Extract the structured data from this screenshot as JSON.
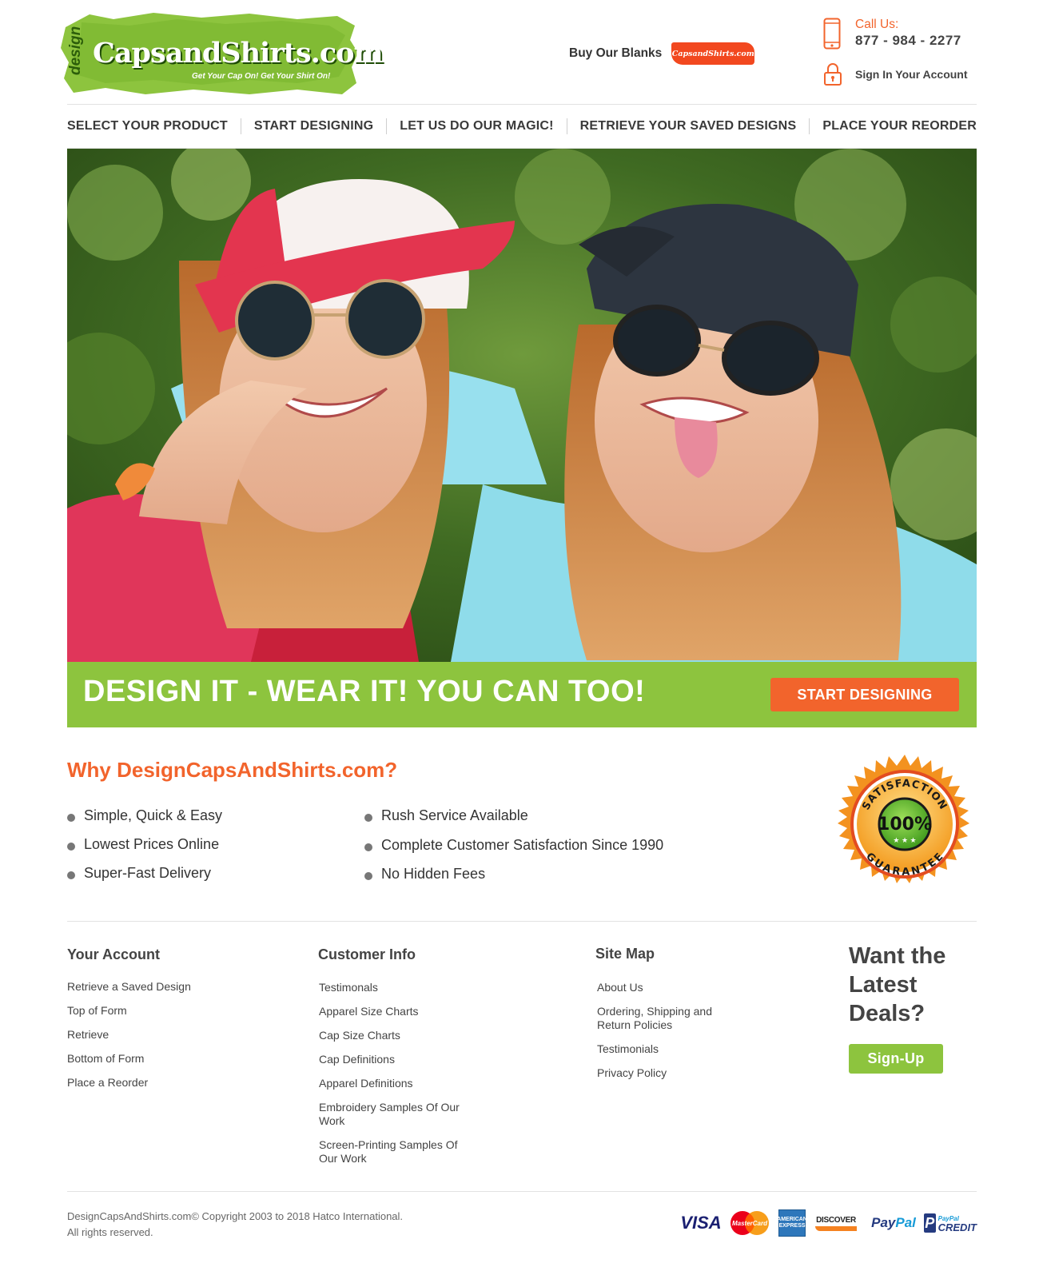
{
  "header": {
    "logo": {
      "prefix": "design",
      "name": "CapsandShirts.com",
      "tagline": "Get Your Cap On! Get Your Shirt On!"
    },
    "blanks_label": "Buy Our Blanks",
    "blanks_badge": "CapsandShirts.com",
    "call_label": "Call Us:",
    "phone": "877 - 984 - 2277",
    "signin_label": "Sign In Your Account"
  },
  "nav": [
    "SELECT YOUR PRODUCT",
    "START DESIGNING",
    "LET US DO OUR MAGIC!",
    "RETRIEVE YOUR SAVED DESIGNS",
    "PLACE YOUR REORDER"
  ],
  "hero": {
    "headline": "DESIGN IT - WEAR IT!  YOU CAN TOO!",
    "cta": "START DESIGNING"
  },
  "why": {
    "title": "Why DesignCapsAndShirts.com?",
    "features_left": [
      "Simple, Quick & Easy",
      "Lowest Prices Online",
      "Super-Fast Delivery"
    ],
    "features_right": [
      "Rush Service Available",
      "Complete Customer Satisfaction Since 1990",
      "No Hidden Fees"
    ],
    "seal": {
      "top": "SATISFACTION",
      "center": "100%",
      "bottom": "GUARANTEE"
    }
  },
  "footer": {
    "account": {
      "heading": "Your Account",
      "links": [
        "Retrieve a Saved Design",
        "Top of Form",
        "Retrieve",
        "Bottom of Form",
        "Place a Reorder"
      ]
    },
    "customer": {
      "heading": "Customer Info",
      "links": [
        "Testimonals",
        "Apparel Size Charts",
        "Cap Size Charts",
        "Cap Definitions",
        "Apparel Definitions",
        "Embroidery Samples Of Our Work",
        "Screen-Printing Samples Of Our Work"
      ]
    },
    "sitemap": {
      "heading": "Site Map",
      "links": [
        "About Us",
        "Ordering, Shipping and Return Policies",
        "Testimonials",
        "Privacy Policy"
      ]
    },
    "deals_heading": "Want the Latest Deals?",
    "signup": "Sign-Up",
    "copyright_line1": "DesignCapsAndShirts.com© Copyright 2003 to 2018 Hatco International.",
    "copyright_line2": "All rights reserved.",
    "payments": {
      "visa": "VISA",
      "mastercard": "MasterCard",
      "amex": "AMERICAN EXPRESS",
      "discover": "DISCOVER",
      "discover_sub": "NETWORK",
      "paypal_a": "Pay",
      "paypal_b": "Pal",
      "paypal_credit_a": "PayPal",
      "paypal_credit_b": "CREDIT"
    }
  }
}
